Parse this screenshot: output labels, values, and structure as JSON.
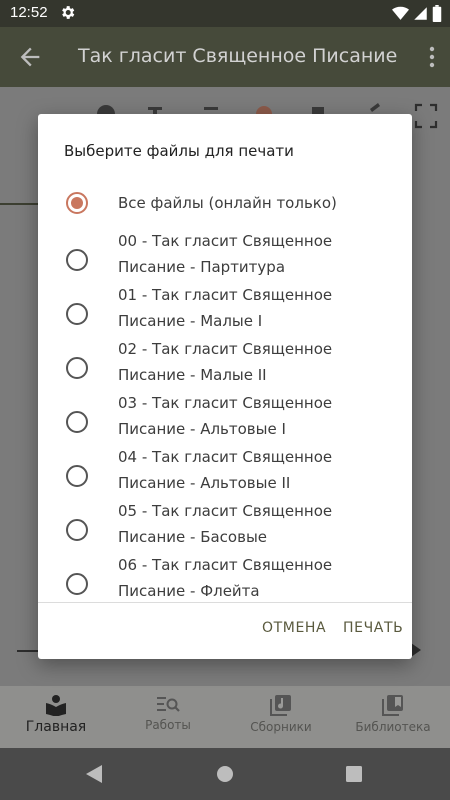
{
  "status_bar": {
    "time": "12:52",
    "icons": [
      "gear-icon",
      "wifi-icon",
      "signal-icon",
      "battery-icon"
    ]
  },
  "app_bar": {
    "title": "Так гласит Священное Писание",
    "back_icon": "arrow-back-icon",
    "menu_icon": "more-vert-icon"
  },
  "dialog": {
    "title": "Выберите файлы для печати",
    "options": [
      {
        "label": "Все файлы (онлайн только)",
        "selected": true
      },
      {
        "label": "00 - Так гласит Священное Писание - Партитура",
        "selected": false
      },
      {
        "label": "01 - Так гласит Священное Писание - Малые I",
        "selected": false
      },
      {
        "label": "02 -  Так гласит Священное Писание - Малые II",
        "selected": false
      },
      {
        "label": "03 - Так гласит Священное Писание - Альтовые I",
        "selected": false
      },
      {
        "label": "04 - Так гласит Священное Писание - Альтовые II",
        "selected": false
      },
      {
        "label": "05 - Так гласит Священное Писание - Басовые",
        "selected": false
      },
      {
        "label": "06 - Так гласит Священное Писание - Флейта",
        "selected": false
      }
    ],
    "cancel_label": "ОТМЕНА",
    "print_label": "ПЕЧАТЬ"
  },
  "bottom_nav": {
    "items": [
      {
        "label": "Главная",
        "icon": "book-reader-icon",
        "active": true
      },
      {
        "label": "Работы",
        "icon": "search-list-icon",
        "active": false
      },
      {
        "label": "Сборники",
        "icon": "music-library-icon",
        "active": false
      },
      {
        "label": "Библиотека",
        "icon": "library-icon",
        "active": false
      }
    ]
  },
  "colors": {
    "accent": "#c9775f",
    "app_bar": "#464a3a",
    "status_bar": "#34362d"
  }
}
